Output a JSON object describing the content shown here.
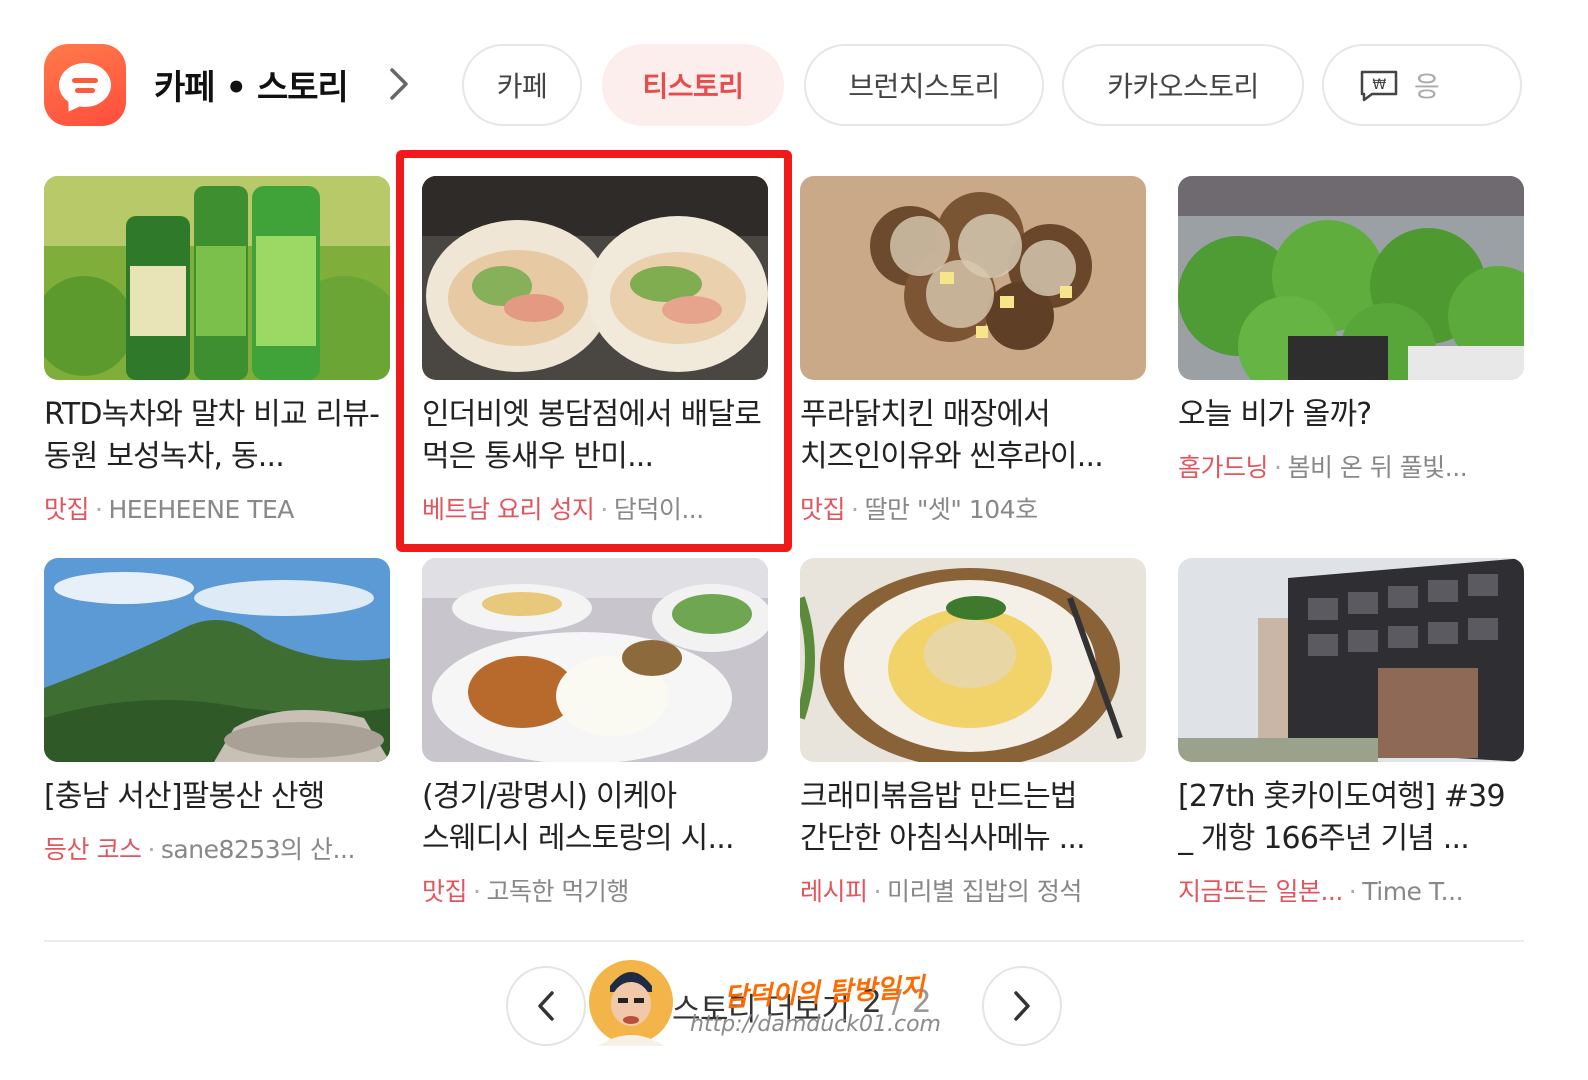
{
  "header": {
    "title": "카페 • 스토리"
  },
  "tabs": [
    {
      "label": "카페",
      "active": false
    },
    {
      "label": "티스토리",
      "active": true
    },
    {
      "label": "브런치스토리",
      "active": false
    },
    {
      "label": "카카오스토리",
      "active": false
    },
    {
      "label": "응",
      "active": false,
      "icon": "won-sign-icon"
    }
  ],
  "cards": [
    {
      "title": "RTD녹차와 말차 비교 리뷰- 동원 보성녹차, 동...",
      "category": "맛집",
      "source": "HEEHEENE TEA",
      "thumb": "green-tea-bottles"
    },
    {
      "title": "인더비엣 봉담점에서 배달로 먹은 통새우 반미...",
      "category": "베트남 요리 성지",
      "source": "담덕이...",
      "thumb": "banh-mi-sandwich",
      "highlighted": true
    },
    {
      "title": "푸라닭치킨 매장에서 치즈인이유와 씬후라이...",
      "category": "맛집",
      "source": "딸만 \"셋\" 104호",
      "thumb": "cheese-chicken"
    },
    {
      "title": "오늘 비가 올까?",
      "category": "홈가드닝",
      "source": "봄비 온 뒤 풀빛...",
      "thumb": "garden-plants"
    },
    {
      "title": "[충남 서산]팔봉산 산행",
      "category": "등산 코스",
      "source": "sane8253의 산...",
      "thumb": "mountain-hike"
    },
    {
      "title": "(경기/광명시) 이케아 스웨디시 레스토랑의 시...",
      "category": "맛집",
      "source": "고독한 먹기행",
      "thumb": "ikea-meal"
    },
    {
      "title": "크래미볶음밥 만드는법 간단한 아침식사메뉴 ...",
      "category": "레시피",
      "source": "미리별 집밥의 정석",
      "thumb": "fried-rice"
    },
    {
      "title": "[27th 홋카이도여행] #39 _ 개항 166주년 기념 ...",
      "category": "지금뜨는 일본...",
      "source": "Time T...",
      "thumb": "city-building"
    }
  ],
  "pager": {
    "more_label": "스토리 더보기",
    "page_current": "2",
    "page_total": "2",
    "page_sep": "/"
  },
  "watermark": {
    "name": "담덕이의 탐방일지",
    "url": "http://damduck01.com"
  },
  "colors": {
    "accent": "#e2555d",
    "tab_active_bg": "#fdeeee",
    "highlight": "#f01a1a",
    "app_icon": "#ff5a3c"
  }
}
